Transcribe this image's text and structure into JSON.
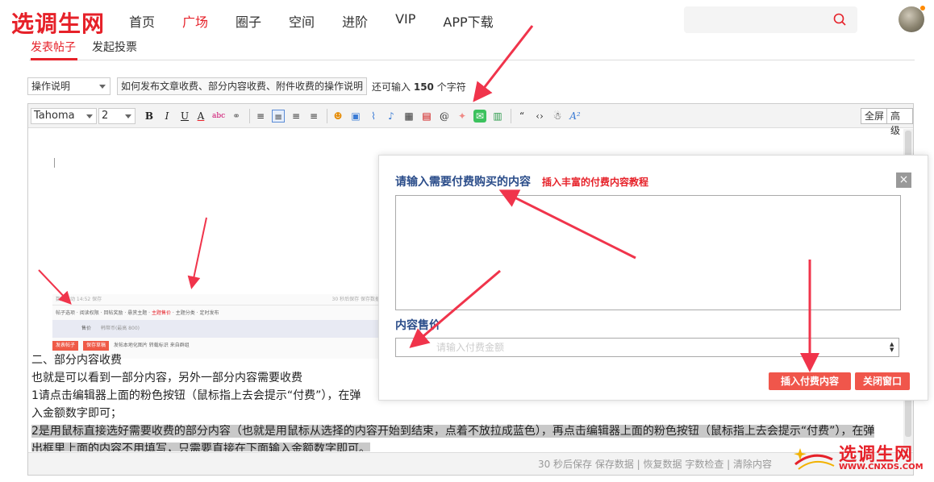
{
  "brand": {
    "logo_text": "选调生网"
  },
  "nav": [
    "首页",
    "广场",
    "圈子",
    "空间",
    "进阶",
    "VIP",
    "APP下载"
  ],
  "nav_active_index": 1,
  "search": {
    "placeholder": ""
  },
  "tabs": {
    "post": "发表帖子",
    "poll": "发起投票"
  },
  "form": {
    "category_select": "操作说明",
    "howto_link": "如何发布文章收费、部分内容收费、附件收费的操作说明",
    "remain_prefix": "还可输入",
    "remain_count": "150",
    "remain_suffix": "个字符"
  },
  "editor_toolbar": {
    "font_family": "Tahoma",
    "font_size": "2",
    "fullscreen": "全屏",
    "advanced": "高级"
  },
  "editor_content": {
    "embedded_screenshot": {
      "top_bar": "数据自动 14:52 保存",
      "top_bar_right": "30 秒后保存 保存数据",
      "tabs": [
        "帖子选项",
        "阅读权限",
        "回帖奖励",
        "悬赏主题",
        "主题售价",
        "主题分类",
        "定时发布"
      ],
      "price_label": "售价",
      "price_value": "韩幣币(最高 800)",
      "btn_post": "发表帖子",
      "btn_draft": "保存草稿",
      "options": "发帖本地化图片  转载标识  来自群组"
    },
    "line1": "二、部分内容收费",
    "line2": "也就是可以看到一部分内容，另外一部分内容需要收费",
    "line3": "1请点击编辑器上面的粉色按钮（鼠标指上去会提示“付费”），在弹",
    "line4": "入金额数字即可；",
    "line5": "2是用鼠标直接选好需要收费的部分内容（也就是用鼠标从选择的内容开始到结束，点着不放拉成蓝色），再点击编辑器上面的粉色按钮（鼠标指上去会提示“付费”），在弹",
    "line6": "出框里上面的内容不用填写，只需要直接在下面输入金额数字即可。"
  },
  "editor_status": "30 秒后保存 保存数据 | 恢复数据    字数检查 | 清除内容",
  "modal": {
    "title": "请输入需要付费购买的内容",
    "help_link": "插入丰富的付费内容教程",
    "close": "×",
    "price_label": "内容售价",
    "price_placeholder": "请输入付费金额",
    "insert_button": "插入付费内容",
    "close_button": "关闭窗口"
  },
  "watermark": {
    "text": "选调生网",
    "url": "WWW.CNXDS.COM"
  },
  "colors": {
    "accent": "#e62129",
    "modal_title": "#2b4d8a",
    "button": "#f0564b"
  }
}
